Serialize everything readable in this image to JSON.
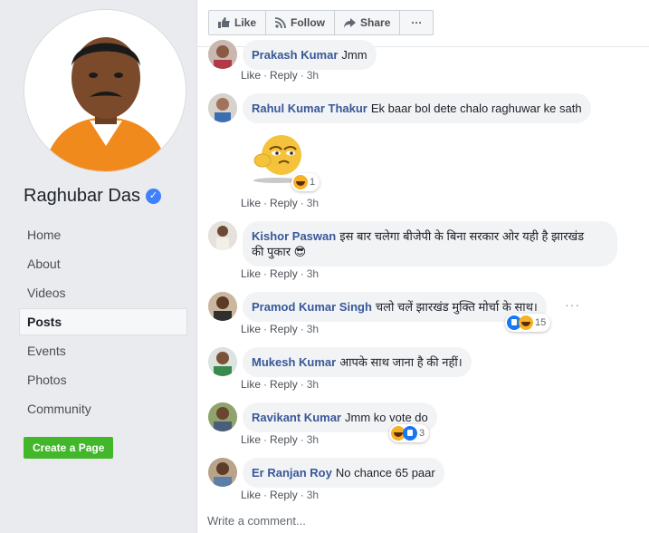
{
  "page": {
    "name": "Raghubar Das",
    "verified_icon": "verified-badge-icon",
    "nav": [
      {
        "label": "Home",
        "active": false
      },
      {
        "label": "About",
        "active": false
      },
      {
        "label": "Videos",
        "active": false
      },
      {
        "label": "Posts",
        "active": true
      },
      {
        "label": "Events",
        "active": false
      },
      {
        "label": "Photos",
        "active": false
      },
      {
        "label": "Community",
        "active": false
      }
    ],
    "create_page_label": "Create a Page"
  },
  "actions": {
    "like": "Like",
    "follow": "Follow",
    "share": "Share",
    "more": "···"
  },
  "comment_actions": {
    "like": "Like",
    "reply": "Reply",
    "separator": "·"
  },
  "comments": [
    {
      "author": "Prakash Kumar",
      "text": "Jmm",
      "time": "3h"
    },
    {
      "author": "Rahul Kumar Thakur",
      "text": "Ek baar bol dete chalo raghuwar ke sath",
      "time": "3h",
      "reaction_count": "1"
    },
    {
      "author": "Kishor Paswan",
      "text": "इस बार चलेगा बीजेपी के बिना सरकार ओर यही है झारखंड",
      "text2": "की पुकार 😎",
      "time": "3h"
    },
    {
      "author": "Pramod Kumar Singh",
      "text": "चलो चलें झारखंड मुक्ति मोर्चा के साथ।",
      "time": "3h",
      "reaction_count": "15"
    },
    {
      "author": "Mukesh Kumar",
      "text": "आपके साथ जाना है की नहीं।",
      "time": "3h"
    },
    {
      "author": "Ravikant Kumar",
      "text": "Jmm ko vote do",
      "time": "3h",
      "reaction_count": "3"
    },
    {
      "author": "Er Ranjan Roy",
      "text": "No chance 65 paar",
      "time": "3h"
    }
  ],
  "write_comment_placeholder": "Write a comment...",
  "colors": {
    "link_blue": "#385898",
    "sidebar_bg": "#e9ebee",
    "create_page_green": "#42b72a",
    "bubble_bg": "#f2f3f5"
  }
}
